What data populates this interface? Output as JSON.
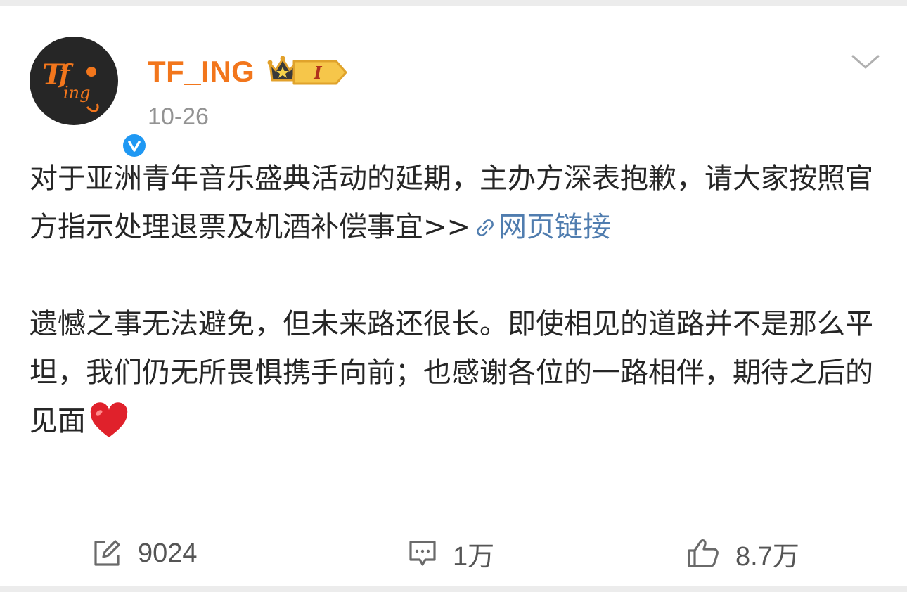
{
  "post": {
    "username": "TF_ING",
    "date": "10-26",
    "vip_level": "I",
    "avatar_text": "ing",
    "paragraph1": "对于亚洲青年音乐盛典活动的延期，主办方深表抱歉，请大家按照官方指示处理退票及机酒补偿事宜>>",
    "link_label": "网页链接",
    "paragraph2": "遗憾之事无法避免，但未来路还很长。即使相见的道路并不是那么平坦，我们仍无所畏惧携手向前；也感谢各位的一路相伴，期待之后的见面",
    "heart_emoji": "red-heart"
  },
  "actions": {
    "repost_count": "9024",
    "comment_count": "1万",
    "like_count": "8.7万"
  },
  "icons": {
    "verified": "verified-check-icon",
    "crown": "crown-icon",
    "more": "chevron-down-icon",
    "link": "link-icon",
    "repost": "repost-edit-icon",
    "comment": "comment-icon",
    "like": "thumbs-up-icon"
  },
  "colors": {
    "username": "#f2761c",
    "link": "#507daf",
    "verified": "#1f98f3",
    "text": "#262626",
    "meta": "#939393"
  }
}
